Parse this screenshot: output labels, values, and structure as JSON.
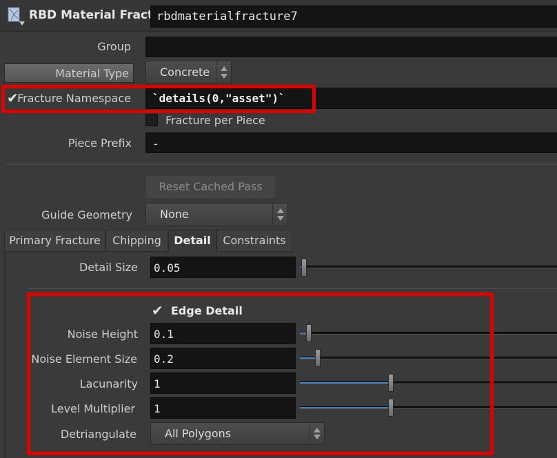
{
  "header": {
    "node_type": "RBD Material Fracture",
    "node_name": "rbdmaterialfracture7",
    "icon": "node-fracture-icon"
  },
  "group": {
    "label": "Group",
    "value": ""
  },
  "material_type": {
    "label": "Material Type",
    "value": "Concrete"
  },
  "fracture_namespace": {
    "label": "Fracture Namespace",
    "value": "`details(0,\"asset\")`",
    "enabled": true
  },
  "fracture_per_piece": {
    "label": "Fracture per Piece",
    "checked": false
  },
  "piece_prefix": {
    "label": "Piece Prefix",
    "value": "-"
  },
  "reset_cached_pass": {
    "label": "Reset Cached Pass"
  },
  "guide_geometry": {
    "label": "Guide Geometry",
    "value": "None"
  },
  "tabs": [
    {
      "label": "Primary Fracture",
      "active": false
    },
    {
      "label": "Chipping",
      "active": false
    },
    {
      "label": "Detail",
      "active": true
    },
    {
      "label": "Constraints",
      "active": false
    }
  ],
  "detail_size": {
    "label": "Detail Size",
    "value": "0.05",
    "slider_fraction": 0.01
  },
  "edge_detail": {
    "label": "Edge Detail",
    "checked": true
  },
  "noise_height": {
    "label": "Noise Height",
    "value": "0.1",
    "slider_fraction": 0.035
  },
  "noise_element_size": {
    "label": "Noise Element Size",
    "value": "0.2",
    "slider_fraction": 0.07
  },
  "lacunarity": {
    "label": "Lacunarity",
    "value": "1",
    "slider_fraction": 0.35
  },
  "level_multiplier": {
    "label": "Level Multiplier",
    "value": "1",
    "slider_fraction": 0.35
  },
  "detriangulate": {
    "label": "Detriangulate",
    "value": "All Polygons"
  },
  "colors": {
    "highlight": "#e00000",
    "slider_fill": "#4a7fbf"
  }
}
